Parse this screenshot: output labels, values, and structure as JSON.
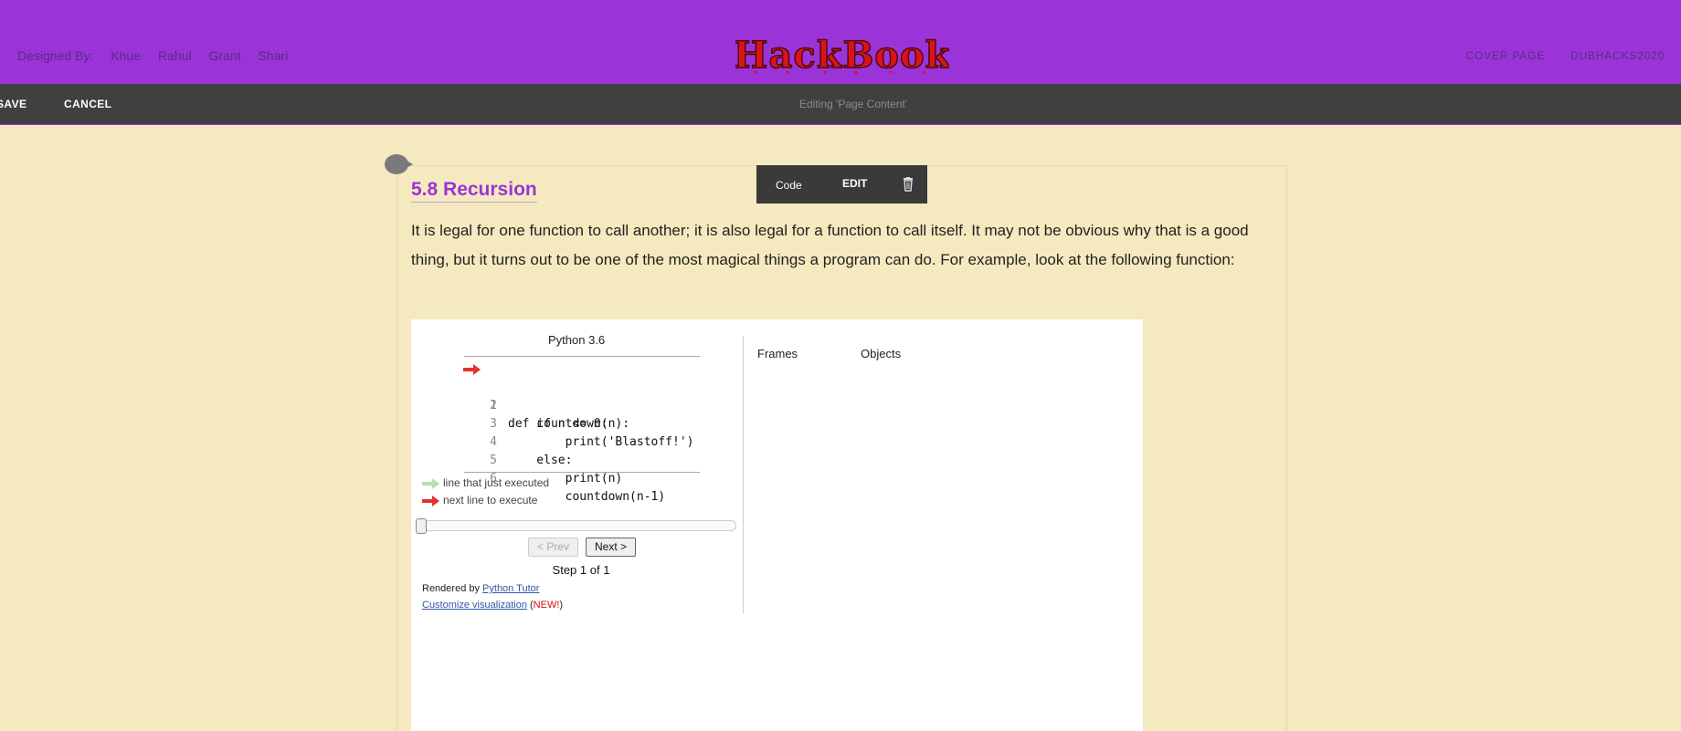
{
  "header": {
    "designed_by_label": "Designed By:",
    "designers": [
      "Khue",
      "Rahul",
      "Grant",
      "Shari"
    ],
    "logo_text": "HackBook",
    "nav": [
      "COVER PAGE",
      "DUBHACKS2020"
    ],
    "brand_color": "#9b34d8"
  },
  "editbar": {
    "save_label": "SAVE",
    "cancel_label": "CANCEL",
    "status": "Editing 'Page Content'"
  },
  "toolbar": {
    "code_label": "Code",
    "edit_label": "EDIT",
    "delete_icon": "trash-icon"
  },
  "content": {
    "heading": "5.8 Recursion",
    "paragraph": "It is legal for one function to call another; it is also legal for a function to call itself. It may not be obvious why that is a good thing, but it turns out to be one of the most magical things a program can do. For example, look at the following function:"
  },
  "tutor": {
    "version": "Python 3.6",
    "code_lines": [
      {
        "num": "1",
        "text": "def countdown(n):"
      },
      {
        "num": "2",
        "text": "    if n <= 0:"
      },
      {
        "num": "3",
        "text": "        print('Blastoff!')"
      },
      {
        "num": "4",
        "text": "    else:"
      },
      {
        "num": "5",
        "text": "        print(n)"
      },
      {
        "num": "6",
        "text": "        countdown(n-1)"
      }
    ],
    "current_line": 1,
    "legend_executed": "line that just executed",
    "legend_next": "next line to execute",
    "prev_label": "< Prev",
    "next_label": "Next >",
    "step_text": "Step 1 of 1",
    "rendered_prefix": "Rendered by ",
    "rendered_link": "Python Tutor",
    "customize_link": "Customize visualization",
    "customize_open": " (",
    "new_tag": "NEW!",
    "customize_close": ")",
    "frames_label": "Frames",
    "objects_label": "Objects",
    "slider_progress": 0,
    "executed_color": "#b7e0b2",
    "next_color": "#e3312d"
  }
}
